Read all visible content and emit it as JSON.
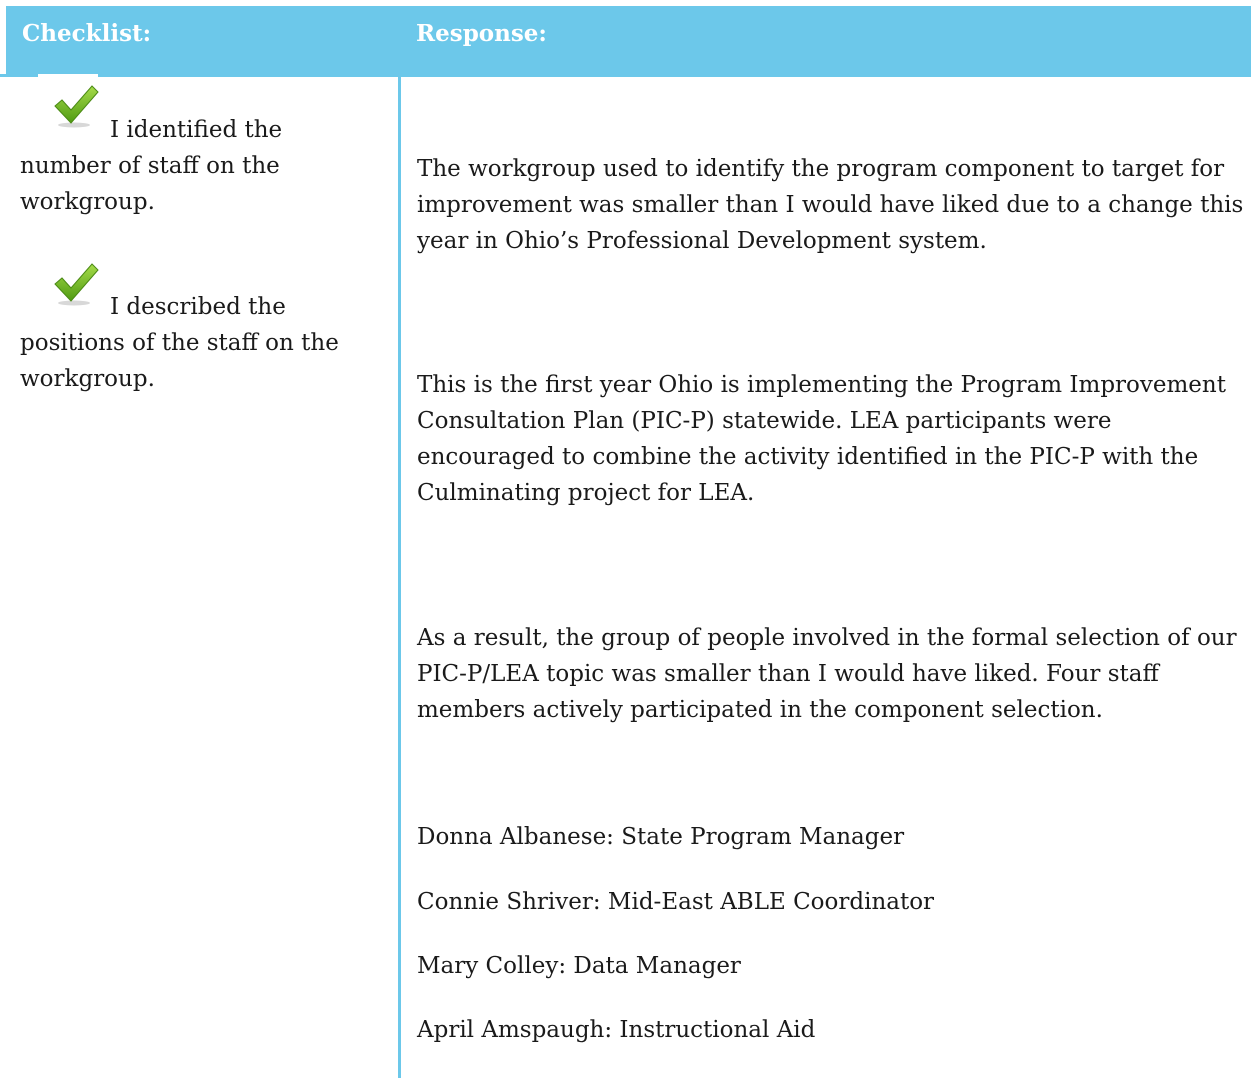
{
  "header": {
    "checklist_label": "Checklist:",
    "response_label": "Response:"
  },
  "checklist": [
    {
      "icon": "checkmark-icon",
      "first_line": "I identified the",
      "rest": "number of staff on the workgroup."
    },
    {
      "icon": "checkmark-icon",
      "first_line": "I described the",
      "rest": "positions  of the staff on the workgroup."
    }
  ],
  "response": {
    "paragraphs": [
      "The workgroup used to identify the program component to target for improvement was smaller than I would have liked due to a change this year in Ohio’s Professional Development system.",
      "This is the first year Ohio is implementing the Program Improvement Consultation Plan (PIC-P) statewide. LEA participants were encouraged to combine the activity identified in the PIC-P with the Culminating project for LEA.",
      "As a result, the group of people involved in the formal selection of our PIC-P/LEA topic was smaller than I would have liked. Four staff members actively participated in the component selection."
    ],
    "staff": [
      "Donna Albanese: State Program Manager",
      "Connie Shriver: Mid-East ABLE Coordinator",
      "Mary Colley: Data Manager",
      "April Amspaugh: Instructional Aid"
    ]
  },
  "colors": {
    "header_bg": "#6cc8ea",
    "check_green": "#6fb51e"
  }
}
